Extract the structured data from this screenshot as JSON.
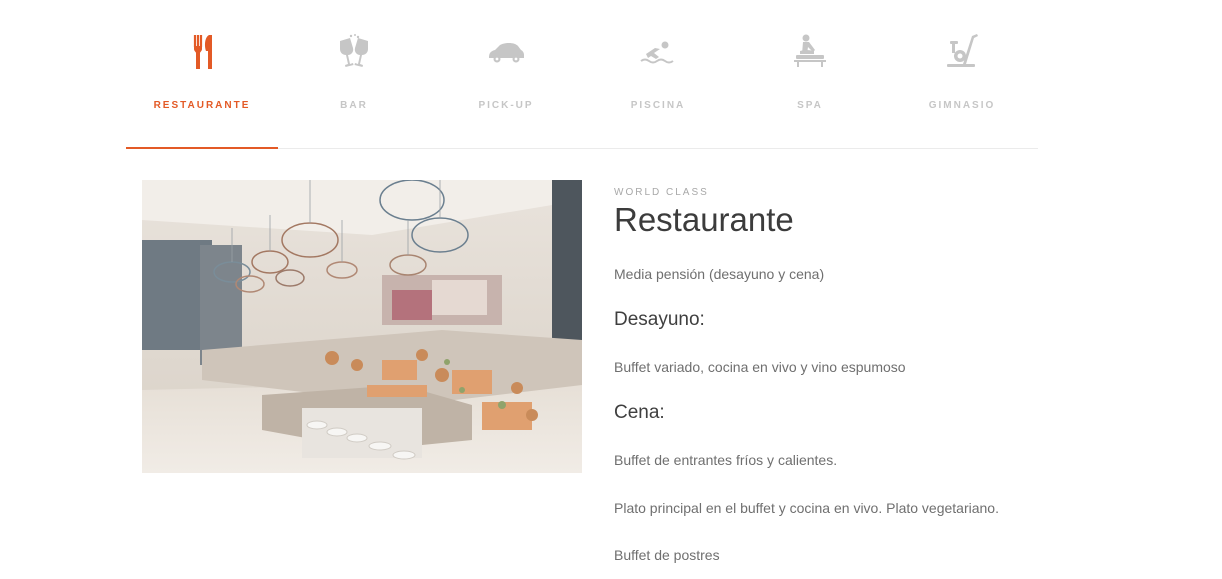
{
  "nav": {
    "tabs": [
      {
        "label": "RESTAURANTE",
        "icon": "fork-knife-icon",
        "active": true
      },
      {
        "label": "BAR",
        "icon": "cocktail-glasses-icon",
        "active": false
      },
      {
        "label": "PICK-UP",
        "icon": "car-icon",
        "active": false
      },
      {
        "label": "PISCINA",
        "icon": "swimmer-icon",
        "active": false
      },
      {
        "label": "SPA",
        "icon": "massage-icon",
        "active": false
      },
      {
        "label": "GIMNASIO",
        "icon": "exercise-bike-icon",
        "active": false
      }
    ]
  },
  "colors": {
    "accent": "#e35a26",
    "inactive_icon": "#c6c6c6",
    "title": "#3c3c3c",
    "body_text": "#6f6f6f"
  },
  "section": {
    "eyebrow": "WORLD CLASS",
    "title": "Restaurante",
    "intro": "Media pensión (desayuno y cena)",
    "breakfast_heading": "Desayuno:",
    "breakfast_text": "Buffet variado, cocina en vivo y vino espumoso",
    "dinner_heading": "Cena:",
    "dinner_items": [
      "Buffet de entrantes fríos y calientes.",
      "Plato principal en el buffet y cocina en vivo. Plato vegetariano.",
      "Buffet de postres"
    ]
  }
}
